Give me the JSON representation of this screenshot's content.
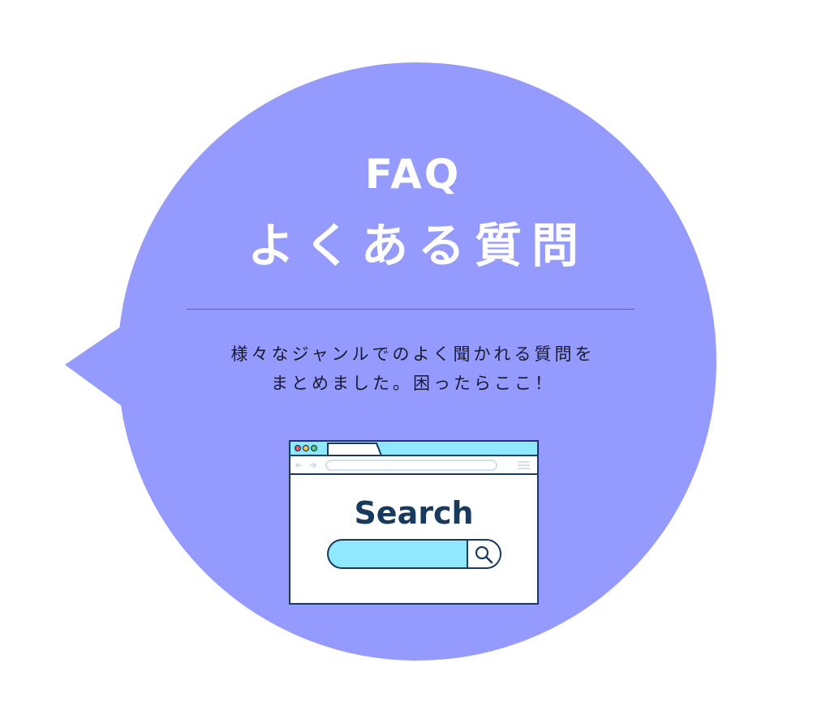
{
  "header": {
    "title_en": "FAQ",
    "title_ja": "よくある質問"
  },
  "description": {
    "line1": "様々なジャンルでのよく聞かれる質問を",
    "line2": "まとめました。困ったらここ！"
  },
  "illustration": {
    "search_word": "Search",
    "icons": [
      "window-dots-icon",
      "back-arrow-icon",
      "forward-arrow-icon",
      "menu-lines-icon",
      "magnifier-icon"
    ]
  },
  "colors": {
    "bubble": "#959afe",
    "text_light": "#ffffff",
    "text_dark": "#1a1a2e",
    "divider": "#5b5fa8",
    "browser_accent": "#8fe8fd",
    "browser_outline": "#173a5e"
  }
}
